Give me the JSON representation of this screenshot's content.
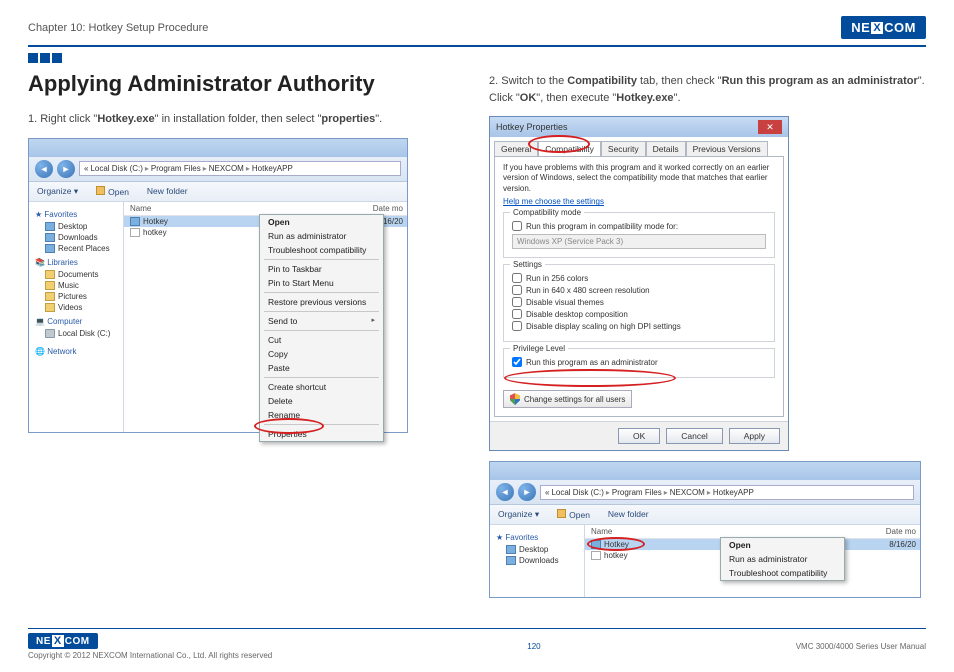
{
  "header": {
    "chapter": "Chapter 10: Hotkey Setup Procedure",
    "logo_text": "NEXCOM"
  },
  "main": {
    "heading": "Applying Administrator Authority",
    "step1_pre": "1. Right click \"",
    "step1_b1": "Hotkey.exe",
    "step1_mid": "\" in installation folder, then select \"",
    "step1_b2": "properties",
    "step1_post": "\".",
    "step2_pre": "2. Switch to the ",
    "step2_b1": "Compatibility",
    "step2_mid1": " tab, then check \"",
    "step2_b2": "Run this program as an administrator",
    "step2_mid2": "\". Click \"",
    "step2_b3": "OK",
    "step2_mid3": "\", then execute \"",
    "step2_b4": "Hotkey.exe",
    "step2_post": "\"."
  },
  "explorer": {
    "breadcrumb": [
      "Local Disk (C:)",
      "Program Files",
      "NEXCOM",
      "HotkeyAPP"
    ],
    "toolbar": {
      "organize": "Organize ▾",
      "open": "Open",
      "newfolder": "New folder"
    },
    "side": {
      "favorites": "Favorites",
      "desktop": "Desktop",
      "downloads": "Downloads",
      "recent": "Recent Places",
      "libraries": "Libraries",
      "documents": "Documents",
      "music": "Music",
      "pictures": "Pictures",
      "videos": "Videos",
      "computer": "Computer",
      "localdisk": "Local Disk (C:)",
      "network": "Network"
    },
    "cols": {
      "name": "Name",
      "date": "Date mo"
    },
    "files": {
      "hotkey_exe": "Hotkey",
      "hotkey_cfg": "hotkey",
      "date1": "8/16/20"
    },
    "context": {
      "open": "Open",
      "runas": "Run as administrator",
      "trouble": "Troubleshoot compatibility",
      "pinTaskbar": "Pin to Taskbar",
      "pinStart": "Pin to Start Menu",
      "restore": "Restore previous versions",
      "sendto": "Send to",
      "cut": "Cut",
      "copy": "Copy",
      "paste": "Paste",
      "shortcut": "Create shortcut",
      "delete": "Delete",
      "rename": "Rename",
      "properties": "Properties"
    }
  },
  "props": {
    "title": "Hotkey Properties",
    "tabs": {
      "general": "General",
      "compat": "Compatibility",
      "security": "Security",
      "details": "Details",
      "prev": "Previous Versions"
    },
    "intro": "If you have problems with this program and it worked correctly on an earlier version of Windows, select the compatibility mode that matches that earlier version.",
    "link": "Help me choose the settings",
    "group_compat": "Compatibility mode",
    "chk_compat": "Run this program in compatibility mode for:",
    "combo_text": "Windows XP (Service Pack 3)",
    "group_settings": "Settings",
    "chk_256": "Run in 256 colors",
    "chk_640": "Run in 640 x 480 screen resolution",
    "chk_themes": "Disable visual themes",
    "chk_compo": "Disable desktop composition",
    "chk_dpi": "Disable display scaling on high DPI settings",
    "group_priv": "Privilege Level",
    "chk_admin": "Run this program as an administrator",
    "change_all": "Change settings for all users",
    "ok": "OK",
    "cancel": "Cancel",
    "apply": "Apply"
  },
  "footer": {
    "copyright": "Copyright © 2012 NEXCOM International Co., Ltd. All rights reserved",
    "pagenum": "120",
    "manual": "VMC 3000/4000 Series User Manual"
  }
}
